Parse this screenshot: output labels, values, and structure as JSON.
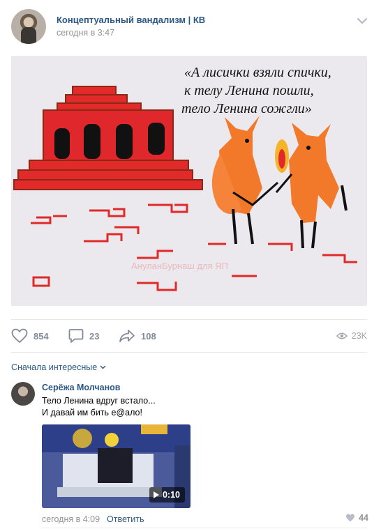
{
  "post": {
    "group_name": "Концептуальный вандализм | КВ",
    "time": "сегодня в 3:47",
    "image": {
      "caption_lines": [
        "«А лисички взяли спички,",
        "к телу Ленина пошли,",
        "тело Ленина сожгли»"
      ],
      "watermark": "АнуланБурнаш для ЯП"
    }
  },
  "actions": {
    "likes": "854",
    "comments": "23",
    "shares": "108",
    "views": "23K"
  },
  "sort_label": "Сначала интересные",
  "comment": {
    "author": "Серёжа Молчанов",
    "text_line1": "Тело Ленина вдруг встало...",
    "text_line2": "И давай им бить е@ало!",
    "video_duration": "0:10",
    "time": "сегодня в 4:09",
    "reply_label": "Ответить",
    "likes": "44"
  },
  "colors": {
    "link": "#2a5885",
    "meta": "#939393",
    "icon": "#828a99"
  }
}
